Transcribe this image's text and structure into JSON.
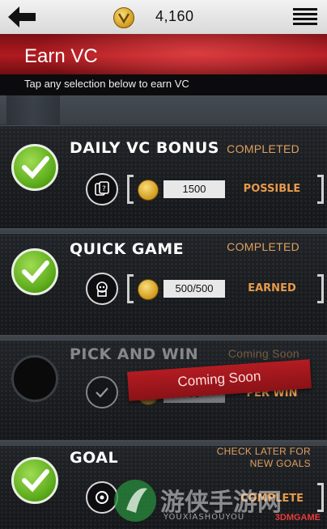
{
  "topbar": {
    "vc_amount": "4,160",
    "back_icon": "back-arrow-icon",
    "menu_icon": "hamburger-menu-icon",
    "coin_icon": "vc-coin-icon"
  },
  "header": {
    "title": "Earn VC",
    "subtitle": "Tap any selection below to earn VC"
  },
  "items": [
    {
      "title": "DAILY VC BONUS",
      "status": "COMPLETED",
      "icon": "card-question-icon",
      "value": "1500",
      "label": "POSSIBLE",
      "state": "complete"
    },
    {
      "title": "QUICK GAME",
      "status": "COMPLETED",
      "icon": "robot-head-icon",
      "value": "500/500",
      "label": "EARNED",
      "state": "complete"
    },
    {
      "title": "PICK AND WIN",
      "status": "Coming Soon",
      "icon": "check-ring-icon",
      "value": "50",
      "label": "PER WIN",
      "state": "disabled",
      "banner": "Coming Soon"
    },
    {
      "title": "GOAL",
      "status_line1": "CHECK LATER FOR",
      "status_line2": "NEW GOALS",
      "icon": "goal-icon",
      "label": "COMPLETE",
      "state": "complete"
    }
  ],
  "watermark": {
    "text": "游侠手游网",
    "sub": "YOUXIASHOUYOU",
    "brand": "3DMGAME"
  }
}
